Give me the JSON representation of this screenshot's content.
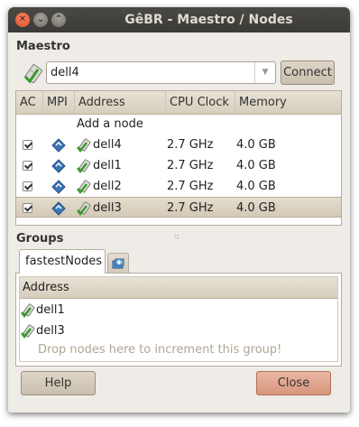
{
  "window": {
    "title": "GêBR - Maestro / Nodes",
    "close_glyph": "✕",
    "minimize_glyph": "⌄",
    "maximize_glyph": "⌃"
  },
  "maestro": {
    "section_label": "Maestro",
    "icon": "server-icon",
    "host_value": "dell4",
    "connect_label": "Connect"
  },
  "nodes": {
    "columns": [
      "AC",
      "MPI",
      "Address",
      "CPU Clock",
      "Memory"
    ],
    "add_node_label": "Add a node",
    "rows": [
      {
        "ac": true,
        "mpi": true,
        "address": "dell4",
        "cpu": "2.7 GHz",
        "memory": "4.0 GB",
        "selected": false
      },
      {
        "ac": true,
        "mpi": true,
        "address": "dell1",
        "cpu": "2.7 GHz",
        "memory": "4.0 GB",
        "selected": false
      },
      {
        "ac": true,
        "mpi": true,
        "address": "dell2",
        "cpu": "2.7 GHz",
        "memory": "4.0 GB",
        "selected": false
      },
      {
        "ac": true,
        "mpi": true,
        "address": "dell3",
        "cpu": "2.7 GHz",
        "memory": "4.0 GB",
        "selected": true
      }
    ]
  },
  "groups": {
    "section_label": "Groups",
    "tab_label": "fastestNodes",
    "column_header": "Address",
    "members": [
      "dell1",
      "dell3"
    ],
    "drop_hint": "Drop nodes here to increment this group!"
  },
  "footer": {
    "help_label": "Help",
    "close_label": "Close"
  },
  "colors": {
    "titlebar": "#3b3a36",
    "window_bg": "#efebe7",
    "selected_row": "#d3c9b6",
    "close_button": "#d9957c"
  }
}
